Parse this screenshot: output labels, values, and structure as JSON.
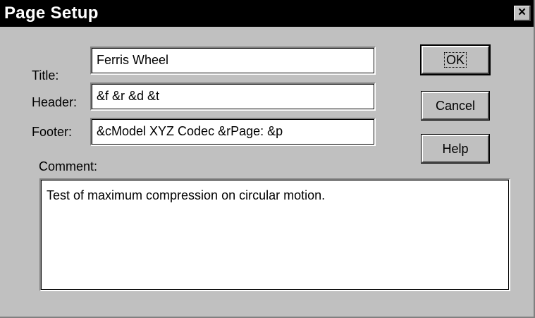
{
  "window": {
    "title": "Page Setup",
    "close_label": "×"
  },
  "form": {
    "title_label": "Title:",
    "title_value": "Ferris Wheel",
    "header_label": "Header:",
    "header_value": "&f &r &d &t",
    "footer_label": "Footer:",
    "footer_value": "&cModel XYZ Codec &rPage: &p",
    "comment_label": "Comment:",
    "comment_value": "Test of maximum compression on circular motion."
  },
  "buttons": {
    "ok_label": "OK",
    "cancel_label": "Cancel",
    "help_label": "Help"
  },
  "colors": {
    "dialog_bg": "#c0c0c0",
    "titlebar_bg": "#000000",
    "titlebar_text": "#ffffff"
  }
}
